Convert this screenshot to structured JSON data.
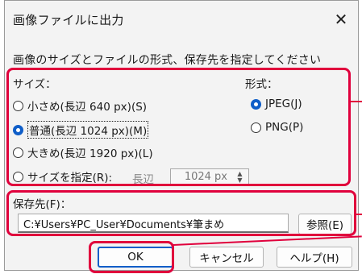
{
  "dialog": {
    "title": "画像ファイルに出力",
    "close_glyph": "✕",
    "instruction": "画像のサイズとファイルの形式、保存先を指定してください"
  },
  "size_group": {
    "label": "サイズ：",
    "options": [
      {
        "label": "小さめ(長辺 640 px)(S)",
        "checked": false
      },
      {
        "label": "普通(長辺 1024 px)(M)",
        "checked": true
      },
      {
        "label": "大きめ(長辺 1920 px)(L)",
        "checked": false
      },
      {
        "label": "サイズを指定(R):",
        "checked": false
      }
    ],
    "custom_side_label": "長辺",
    "custom_value": "1024 px"
  },
  "format_group": {
    "label": "形式：",
    "options": [
      {
        "label": "JPEG(J)",
        "checked": true
      },
      {
        "label": "PNG(P)",
        "checked": false
      }
    ]
  },
  "destination": {
    "label": "保存先(F)：",
    "path": "C:¥Users¥PC_User¥Documents¥筆まめ",
    "browse_label": "参照(E)"
  },
  "buttons": {
    "ok_label": "OK",
    "cancel_label": "キャンセル",
    "help_label": "ヘルプ(H)"
  },
  "colors": {
    "accent": "#0f5ec8",
    "annotation": "#e0003c"
  },
  "icons": {
    "close": "close-icon",
    "spin_up": "chevron-up-icon",
    "spin_down": "chevron-down-icon"
  }
}
